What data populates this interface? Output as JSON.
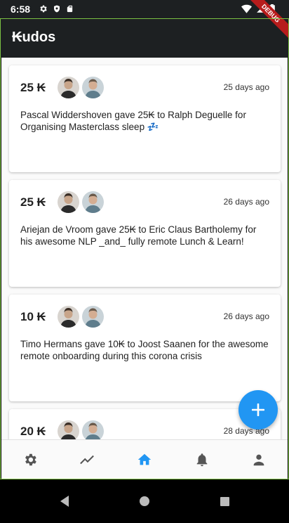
{
  "status_bar": {
    "time": "6:58"
  },
  "app": {
    "title": "₭udos",
    "debug_banner": "DEBUG"
  },
  "kudos": [
    {
      "amount": "25 ₭",
      "time_ago": "25 days ago",
      "message": "Pascal Widdershoven gave 25₭ to Ralph Deguelle for Organising Masterclass sleep 💤"
    },
    {
      "amount": "25 ₭",
      "time_ago": "26 days ago",
      "message": "Ariejan de Vroom  gave 25₭ to Eric Claus Bartholemy for his awesome NLP _and_ fully remote Lunch & Learn!"
    },
    {
      "amount": "10 ₭",
      "time_ago": "26 days ago",
      "message": "Timo Hermans gave 10₭ to Joost Saanen for the awesome remote onboarding during this corona crisis"
    },
    {
      "amount": "20 ₭",
      "time_ago": "28 days ago",
      "message": ""
    }
  ],
  "bottom_nav": {
    "active": "home",
    "items": [
      "settings-icon",
      "trending-icon",
      "home-icon",
      "notifications-icon",
      "profile-icon"
    ]
  },
  "colors": {
    "app_bar": "#1d2022",
    "accent": "#2196f3",
    "inactive_icon": "#555555"
  }
}
